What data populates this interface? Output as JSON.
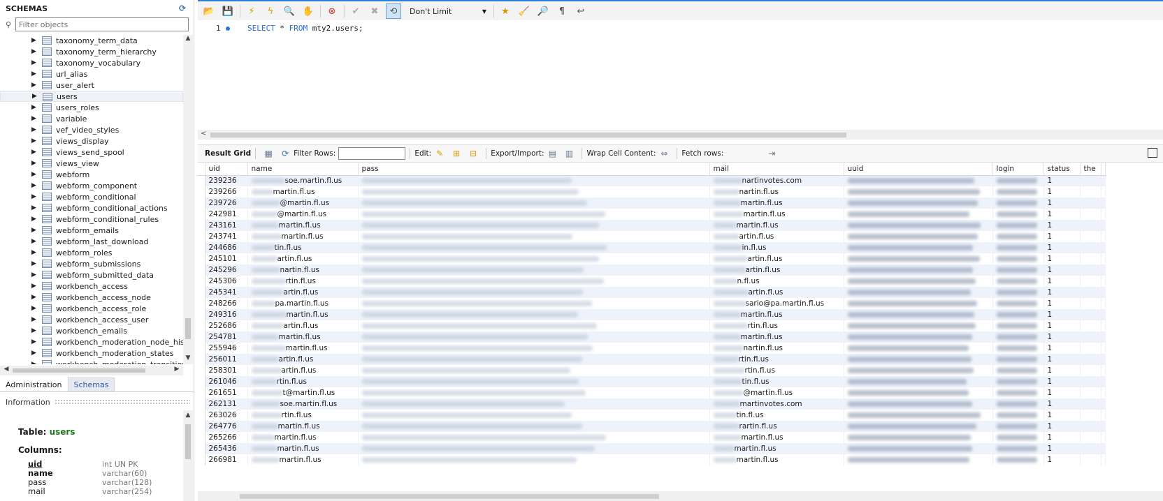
{
  "sidebar": {
    "title": "SCHEMAS",
    "filter_placeholder": "Filter objects",
    "tree_items": [
      "taxonomy_term_data",
      "taxonomy_term_hierarchy",
      "taxonomy_vocabulary",
      "url_alias",
      "user_alert",
      "users",
      "users_roles",
      "variable",
      "vef_video_styles",
      "views_display",
      "views_send_spool",
      "views_view",
      "webform",
      "webform_component",
      "webform_conditional",
      "webform_conditional_actions",
      "webform_conditional_rules",
      "webform_emails",
      "webform_last_download",
      "webform_roles",
      "webform_submissions",
      "webform_submitted_data",
      "workbench_access",
      "workbench_access_node",
      "workbench_access_role",
      "workbench_access_user",
      "workbench_emails",
      "workbench_moderation_node_history",
      "workbench_moderation_states",
      "workbench_moderation_transitions"
    ],
    "selected_item": "users",
    "tabs": {
      "administration": "Administration",
      "schemas": "Schemas"
    },
    "info_header": "Information",
    "info": {
      "table_label": "Table:",
      "table_name": "users",
      "columns_label": "Columns:",
      "columns": [
        {
          "name": "uid",
          "type": "int UN PK"
        },
        {
          "name": "name",
          "type": "varchar(60)"
        },
        {
          "name": "pass",
          "type": "varchar(128)"
        },
        {
          "name": "mail",
          "type": "varchar(254)"
        }
      ]
    }
  },
  "toolbar": {
    "limit_label": "Don't Limit"
  },
  "editor": {
    "line_number": "1",
    "sql_kw1": "SELECT",
    "sql_mid": " * ",
    "sql_kw2": "FROM",
    "sql_rest": " mty2.users;"
  },
  "result_toolbar": {
    "result_grid": "Result Grid",
    "filter_rows": "Filter Rows:",
    "edit": "Edit:",
    "export_import": "Export/Import:",
    "wrap": "Wrap Cell Content:",
    "fetch": "Fetch rows:"
  },
  "grid": {
    "columns": [
      "uid",
      "name",
      "pass",
      "mail",
      "uuid",
      "login",
      "status",
      "the"
    ],
    "rows": [
      {
        "uid": "239236",
        "name": "soe.martin.fl.us",
        "mail": "nartinvotes.com",
        "status": "1"
      },
      {
        "uid": "239266",
        "name": "martin.fl.us",
        "mail": "nartin.fl.us",
        "status": "1"
      },
      {
        "uid": "239726",
        "name": "@martin.fl.us",
        "mail": "martin.fl.us",
        "status": "1"
      },
      {
        "uid": "242981",
        "name": "@martin.fl.us",
        "mail": "martin.fl.us",
        "status": "1"
      },
      {
        "uid": "243161",
        "name": "martin.fl.us",
        "mail": "martin.fl.us",
        "status": "1"
      },
      {
        "uid": "243741",
        "name": "martin.fl.us",
        "mail": "artin.fl.us",
        "status": "1"
      },
      {
        "uid": "244686",
        "name": "tin.fl.us",
        "mail": "in.fl.us",
        "status": "1"
      },
      {
        "uid": "245101",
        "name": "artin.fl.us",
        "mail": "artin.fl.us",
        "status": "1"
      },
      {
        "uid": "245296",
        "name": "nartin.fl.us",
        "mail": "artin.fl.us",
        "status": "1"
      },
      {
        "uid": "245306",
        "name": "rtin.fl.us",
        "mail": "n.fl.us",
        "status": "1"
      },
      {
        "uid": "245341",
        "name": "artin.fl.us",
        "mail": "artin.fl.us",
        "status": "1"
      },
      {
        "uid": "248266",
        "name": "pa.martin.fl.us",
        "mail": "sario@pa.martin.fl.us",
        "status": "1"
      },
      {
        "uid": "249316",
        "name": "martin.fl.us",
        "mail": "martin.fl.us",
        "status": "1"
      },
      {
        "uid": "252686",
        "name": "artin.fl.us",
        "mail": "rtin.fl.us",
        "status": "1"
      },
      {
        "uid": "254781",
        "name": "martin.fl.us",
        "mail": "martin.fl.us",
        "status": "1"
      },
      {
        "uid": "255946",
        "name": "martin.fl.us",
        "mail": "nartin.fl.us",
        "status": "1"
      },
      {
        "uid": "256011",
        "name": "artin.fl.us",
        "mail": "rtin.fl.us",
        "status": "1"
      },
      {
        "uid": "258301",
        "name": "artin.fl.us",
        "mail": "rtin.fl.us",
        "status": "1"
      },
      {
        "uid": "261046",
        "name": "rtin.fl.us",
        "mail": "tin.fl.us",
        "status": "1"
      },
      {
        "uid": "261651",
        "name": "t@martin.fl.us",
        "mail": "@martin.fl.us",
        "status": "1"
      },
      {
        "uid": "262131",
        "name": "soe.martin.fl.us",
        "mail": "martinvotes.com",
        "status": "1"
      },
      {
        "uid": "263026",
        "name": "rtin.fl.us",
        "mail": "tin.fl.us",
        "status": "1"
      },
      {
        "uid": "264776",
        "name": "martin.fl.us",
        "mail": "rartin.fl.us",
        "status": "1"
      },
      {
        "uid": "265266",
        "name": "martin.fl.us",
        "mail": "martin.fl.us",
        "status": "1"
      },
      {
        "uid": "265436",
        "name": "martin.fl.us",
        "mail": "martin.fl.us",
        "status": "1"
      },
      {
        "uid": "266981",
        "name": "martin.fl.us",
        "mail": "martin.fl.us",
        "status": "1"
      }
    ]
  },
  "colors": {
    "accent": "#2d7ed6",
    "row_alt": "#eef3fb",
    "table_name": "#1e7b1e",
    "keyword": "#2a6bd6"
  }
}
